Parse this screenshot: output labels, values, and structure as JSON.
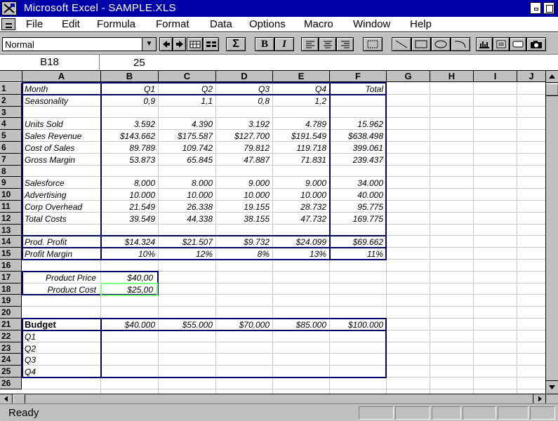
{
  "window": {
    "title": "Microsoft Excel - SAMPLE.XLS",
    "title_bar_color": "#0000a8"
  },
  "menu": {
    "items": [
      {
        "id": "file",
        "label": "File"
      },
      {
        "id": "edit",
        "label": "Edit"
      },
      {
        "id": "formula",
        "label": "Formula"
      },
      {
        "id": "format",
        "label": "Format"
      },
      {
        "id": "data",
        "label": "Data"
      },
      {
        "id": "options",
        "label": "Options"
      },
      {
        "id": "macro",
        "label": "Macro"
      },
      {
        "id": "window",
        "label": "Window"
      },
      {
        "id": "help",
        "label": "Help"
      }
    ]
  },
  "toolbar": {
    "style_value": "Normal",
    "buttons": [
      {
        "id": "promote",
        "icon": "arrow-left-icon"
      },
      {
        "id": "demote",
        "icon": "arrow-right-icon"
      },
      {
        "id": "outline",
        "icon": "outline-icon"
      },
      {
        "id": "select-visible",
        "icon": "select-visible-icon"
      },
      {
        "id": "autosum",
        "icon": "sigma-icon",
        "label": "Σ"
      },
      {
        "id": "bold",
        "icon": "bold-icon",
        "label": "B"
      },
      {
        "id": "italic",
        "icon": "italic-icon",
        "label": "I"
      },
      {
        "id": "align-left",
        "icon": "align-left-icon"
      },
      {
        "id": "align-center",
        "icon": "align-center-icon"
      },
      {
        "id": "align-right",
        "icon": "align-right-icon"
      },
      {
        "id": "border",
        "icon": "border-icon"
      },
      {
        "id": "line",
        "icon": "line-icon"
      },
      {
        "id": "rectangle",
        "icon": "rectangle-icon"
      },
      {
        "id": "oval",
        "icon": "oval-icon"
      },
      {
        "id": "arc",
        "icon": "arc-icon"
      },
      {
        "id": "chart",
        "icon": "chart-icon"
      },
      {
        "id": "textbox",
        "icon": "textbox-icon"
      },
      {
        "id": "button-tool",
        "icon": "button-tool-icon"
      },
      {
        "id": "camera",
        "icon": "camera-icon"
      }
    ]
  },
  "formula_bar": {
    "cell_ref": "B18",
    "value": "25"
  },
  "columns": [
    "A",
    "B",
    "C",
    "D",
    "E",
    "F",
    "G",
    "H",
    "I",
    "J"
  ],
  "rows": [
    {
      "n": "1",
      "cells": {
        "A": "Month",
        "B": "Q1",
        "C": "Q2",
        "D": "Q3",
        "E": "Q4",
        "F": "Total"
      }
    },
    {
      "n": "2",
      "cells": {
        "A": "Seasonality",
        "B": "0,9",
        "C": "1,1",
        "D": "0,8",
        "E": "1,2"
      }
    },
    {
      "n": "3",
      "cells": {}
    },
    {
      "n": "4",
      "cells": {
        "A": "Units Sold",
        "B": "3.592",
        "C": "4.390",
        "D": "3.192",
        "E": "4.789",
        "F": "15.962"
      }
    },
    {
      "n": "5",
      "cells": {
        "A": "Sales Revenue",
        "B": "$143.662",
        "C": "$175.587",
        "D": "$127.700",
        "E": "$191.549",
        "F": "$638.498"
      }
    },
    {
      "n": "6",
      "cells": {
        "A": "Cost of Sales",
        "B": "89.789",
        "C": "109.742",
        "D": "79.812",
        "E": "119.718",
        "F": "399.061"
      }
    },
    {
      "n": "7",
      "cells": {
        "A": "Gross Margin",
        "B": "53.873",
        "C": "65.845",
        "D": "47.887",
        "E": "71.831",
        "F": "239.437"
      }
    },
    {
      "n": "8",
      "cells": {}
    },
    {
      "n": "9",
      "cells": {
        "A": "Salesforce",
        "B": "8.000",
        "C": "8.000",
        "D": "9.000",
        "E": "9.000",
        "F": "34.000"
      }
    },
    {
      "n": "10",
      "cells": {
        "A": "Advertising",
        "B": "10.000",
        "C": "10.000",
        "D": "10.000",
        "E": "10.000",
        "F": "40.000"
      }
    },
    {
      "n": "11",
      "cells": {
        "A": "Corp Overhead",
        "B": "21.549",
        "C": "26.338",
        "D": "19.155",
        "E": "28.732",
        "F": "95.775"
      }
    },
    {
      "n": "12",
      "cells": {
        "A": "Total Costs",
        "B": "39.549",
        "C": "44.338",
        "D": "38.155",
        "E": "47.732",
        "F": "169.775"
      }
    },
    {
      "n": "13",
      "cells": {}
    },
    {
      "n": "14",
      "cells": {
        "A": "Prod. Profit",
        "B": "$14.324",
        "C": "$21.507",
        "D": "$9.732",
        "E": "$24.099",
        "F": "$69.662"
      }
    },
    {
      "n": "15",
      "cells": {
        "A": "Profit Margin",
        "B": "10%",
        "C": "12%",
        "D": "8%",
        "E": "13%",
        "F": "11%"
      }
    },
    {
      "n": "16",
      "cells": {}
    },
    {
      "n": "17",
      "cells": {
        "A": "Product Price",
        "B": "$40,00"
      }
    },
    {
      "n": "18",
      "cells": {
        "A": "Product Cost",
        "B": "$25,00"
      }
    },
    {
      "n": "19",
      "cells": {}
    },
    {
      "n": "20",
      "cells": {}
    },
    {
      "n": "21",
      "cells": {
        "A": "Budget",
        "B": "$40.000",
        "C": "$55.000",
        "D": "$70.000",
        "E": "$85.000",
        "F": "$100.000"
      }
    },
    {
      "n": "22",
      "cells": {
        "A": "Q1"
      }
    },
    {
      "n": "23",
      "cells": {
        "A": "Q2"
      }
    },
    {
      "n": "24",
      "cells": {
        "A": "Q3"
      }
    },
    {
      "n": "25",
      "cells": {
        "A": "Q4"
      }
    },
    {
      "n": "26",
      "cells": {}
    }
  ],
  "selected_cell": "B18",
  "selection_color": "#80ff80",
  "status": {
    "text": "Ready"
  }
}
